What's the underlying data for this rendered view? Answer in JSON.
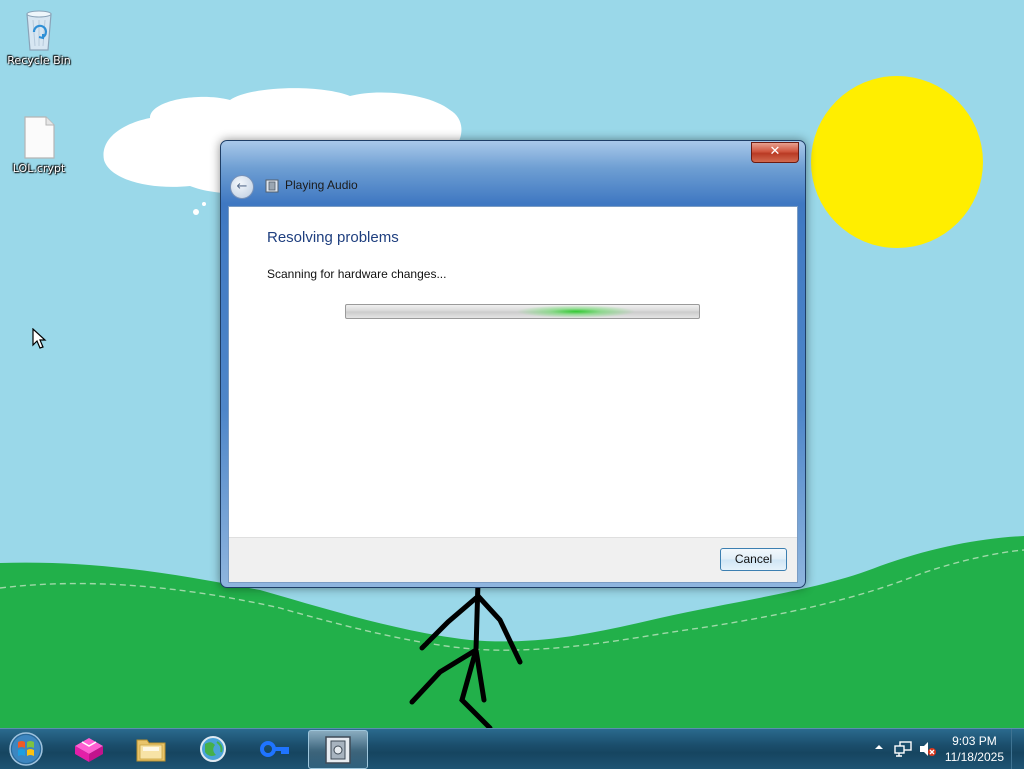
{
  "desktop": {
    "icons": [
      {
        "label": "Recycle Bin",
        "icon": "recycle-bin-icon"
      },
      {
        "label": "LOL.crypt",
        "icon": "file-icon"
      }
    ]
  },
  "dialog": {
    "title": "Playing Audio",
    "heading": "Resolving problems",
    "status": "Scanning for hardware changes...",
    "close_label": "✕",
    "back_label": "←",
    "cancel_label": "Cancel"
  },
  "taskbar": {
    "items": [
      {
        "icon": "windows-start-icon"
      },
      {
        "icon": "magenta-box-app-icon"
      },
      {
        "icon": "file-explorer-icon"
      },
      {
        "icon": "globe-browser-icon"
      },
      {
        "icon": "key-app-icon"
      },
      {
        "icon": "playing-audio-troubleshooter-icon",
        "active": true
      }
    ],
    "tray": {
      "time": "9:03 PM",
      "date": "11/18/2025",
      "icons": [
        "show-hidden-icons-icon",
        "network-icon",
        "volume-muted-icon"
      ]
    }
  },
  "colors": {
    "sky": "#9ad8e9",
    "grass": "#22b04a",
    "sun": "#ffee00",
    "dialog_heading": "#1f3f7f",
    "taskbar": "#1b4e6c"
  }
}
